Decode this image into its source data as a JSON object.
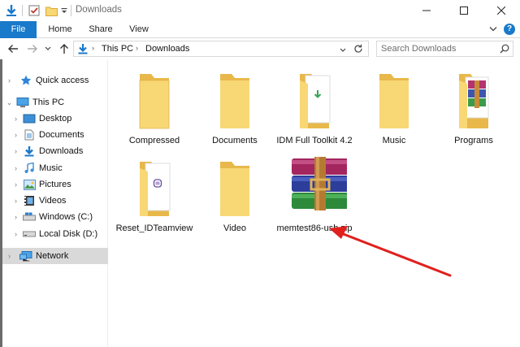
{
  "window": {
    "title": "Downloads",
    "controls": [
      "minimize-icon",
      "maximize-icon",
      "close-icon"
    ]
  },
  "ribbon": {
    "tabs": [
      {
        "label": "File",
        "active": true
      },
      {
        "label": "Home"
      },
      {
        "label": "Share"
      },
      {
        "label": "View"
      }
    ],
    "help_label": "?"
  },
  "address": {
    "crumbs": [
      "This PC",
      "Downloads"
    ],
    "search_placeholder": "Search Downloads"
  },
  "nav": {
    "items": [
      {
        "label": "Quick access",
        "icon": "star-icon"
      },
      {
        "label": "This PC",
        "icon": "computer-icon"
      },
      {
        "label": "Desktop",
        "icon": "desktop-icon"
      },
      {
        "label": "Documents",
        "icon": "documents-icon"
      },
      {
        "label": "Downloads",
        "icon": "download-icon"
      },
      {
        "label": "Music",
        "icon": "music-icon"
      },
      {
        "label": "Pictures",
        "icon": "pictures-icon"
      },
      {
        "label": "Videos",
        "icon": "videos-icon"
      },
      {
        "label": "Windows (C:)",
        "icon": "drive-icon"
      },
      {
        "label": "Local Disk (D:)",
        "icon": "drive-icon"
      },
      {
        "label": "Network",
        "icon": "network-icon",
        "selected": true
      }
    ]
  },
  "files": [
    {
      "name": "Compressed",
      "type": "folder"
    },
    {
      "name": "Documents",
      "type": "folder"
    },
    {
      "name": "IDM Full Toolkit 4.2",
      "type": "folder-with-file"
    },
    {
      "name": "Music",
      "type": "folder"
    },
    {
      "name": "Programs",
      "type": "folder-with-winrar"
    },
    {
      "name": "Reset_IDTeamview",
      "type": "folder-with-file"
    },
    {
      "name": "Video",
      "type": "folder"
    },
    {
      "name": "memtest86-usb.zip",
      "type": "winrar-archive"
    }
  ],
  "colors": {
    "accent": "#1979ca",
    "folder": "#f8d775",
    "folder_dark": "#e8b84a",
    "annotation_arrow": "#e0201c",
    "selected_bg": "#d9d9d9"
  }
}
